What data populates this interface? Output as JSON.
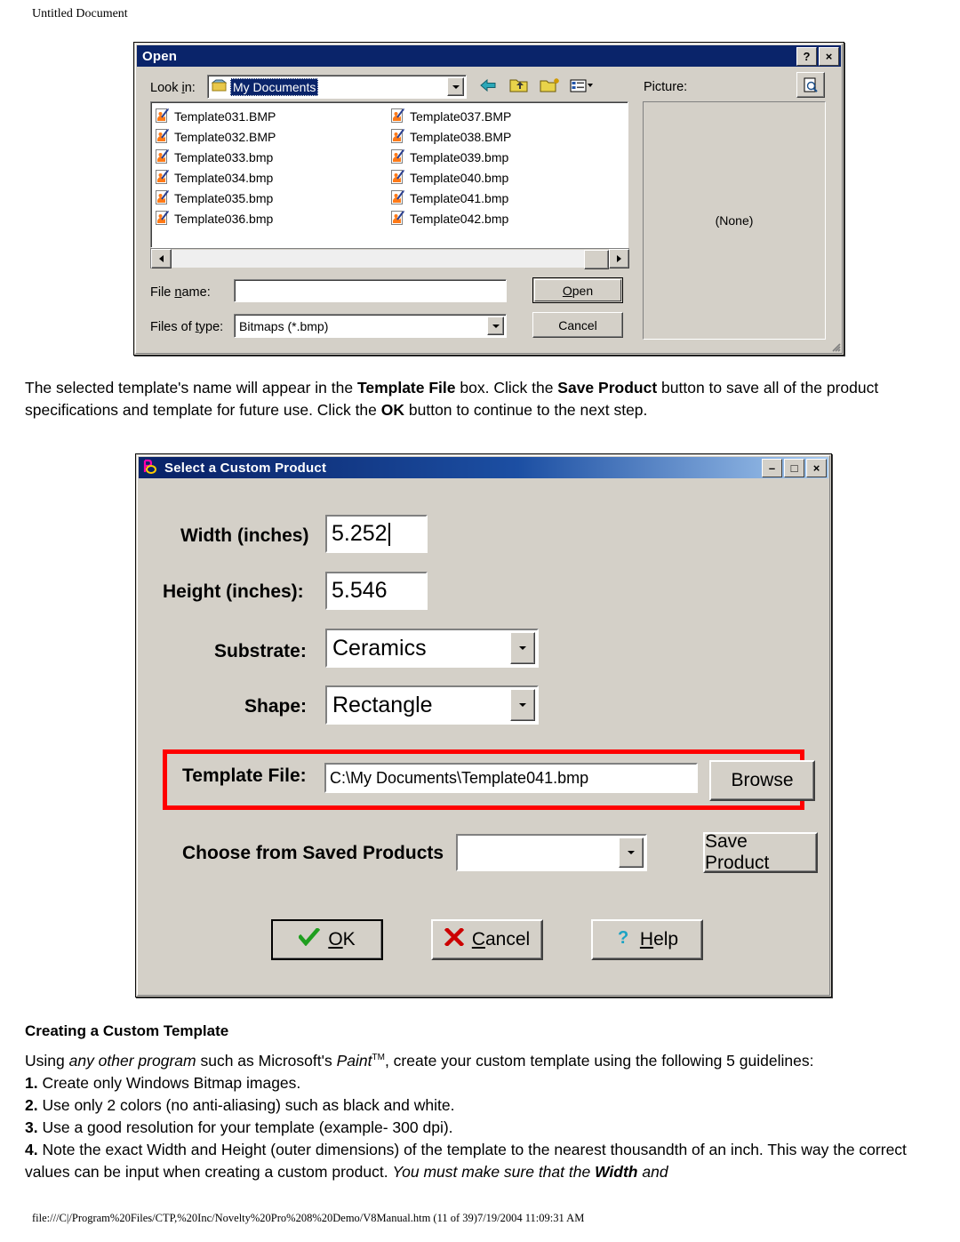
{
  "page": {
    "header_title": "Untitled Document",
    "footer": "file:///C|/Program%20Files/CTP,%20Inc/Novelty%20Pro%208%20Demo/V8Manual.htm (11 of 39)7/19/2004 11:09:31 AM"
  },
  "open_dialog": {
    "title": "Open",
    "help_button": "?",
    "close_button": "×",
    "lookin_label": "Look in:",
    "lookin_value": "My Documents",
    "toolbar_icons": [
      "back-arrow-icon",
      "up-one-level-icon",
      "new-folder-icon",
      "views-icon"
    ],
    "files": [
      "Template031.BMP",
      "Template032.BMP",
      "Template033.bmp",
      "Template034.bmp",
      "Template035.bmp",
      "Template036.bmp",
      "Template037.BMP",
      "Template038.BMP",
      "Template039.bmp",
      "Template040.bmp",
      "Template041.bmp",
      "Template042.bmp"
    ],
    "filename_label": "File name:",
    "filename_value": "",
    "filetype_label": "Files of type:",
    "filetype_value": "Bitmaps (*.bmp)",
    "open_button": "Open",
    "cancel_button": "Cancel",
    "picture_label": "Picture:",
    "picture_preview": "(None)"
  },
  "paragraph1": {
    "p1": "The selected template's name will appear in the ",
    "b1": "Template File",
    "p2": " box. Click the ",
    "b2": "Save Product",
    "p3": " button to save all of the product specifications and template for future use. Click the ",
    "b3": "OK",
    "p4": " button to continue to the next step."
  },
  "product_dialog": {
    "title": "Select a Custom Product",
    "minimize_button": "–",
    "maximize_button": "□",
    "close_button": "×",
    "width_label": "Width (inches)",
    "width_value": "5.252",
    "height_label": "Height (inches):",
    "height_value": "5.546",
    "substrate_label": "Substrate:",
    "substrate_value": "Ceramics",
    "shape_label": "Shape:",
    "shape_value": "Rectangle",
    "template_file_label": "Template File:",
    "template_file_value": "C:\\My Documents\\Template041.bmp",
    "browse_button": "Browse",
    "saved_products_label": "Choose from Saved Products",
    "saved_products_value": "",
    "save_product_button": "Save Product",
    "ok_button": "OK",
    "cancel_button": "Cancel",
    "help_button": "Help",
    "highlight_color": "#ff0000"
  },
  "section": {
    "heading": "Creating a Custom Template",
    "intro_a": "Using ",
    "intro_i": "any other program",
    "intro_b": " such as Microsoft's ",
    "intro_i2": "Paint",
    "intro_tm": "TM",
    "intro_c": ", create your custom template using the following 5 guidelines:",
    "g1_num": "1.",
    "g1": " Create only Windows Bitmap images.",
    "g2_num": "2.",
    "g2": " Use only 2 colors (no anti-aliasing) such as black and white.",
    "g3_num": "3.",
    "g3": " Use a good resolution for your template (example- 300 dpi).",
    "g4_num": "4.",
    "g4": " Note the exact Width and Height (outer dimensions) of the template to the nearest thousandth of an inch. This way the correct values can be input when creating a custom product. ",
    "g4_i": "You must make sure that the ",
    "g4_ib": "Width",
    "g4_i2": " and"
  }
}
